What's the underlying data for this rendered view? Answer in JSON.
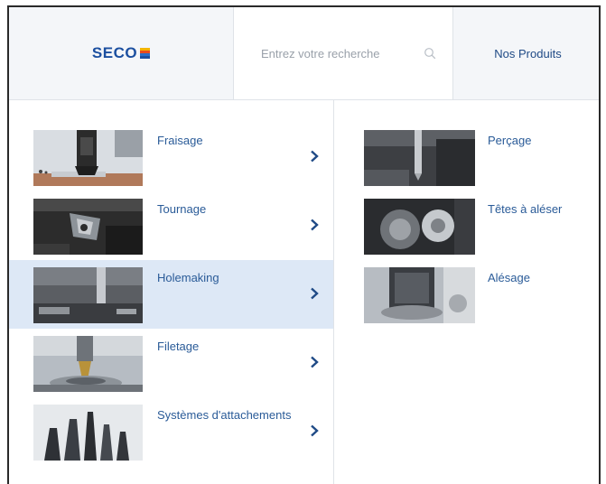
{
  "header": {
    "logo_text": "SECO",
    "search_placeholder": "Entrez votre recherche",
    "products_label": "Nos Produits"
  },
  "categories": [
    {
      "label": "Fraisage",
      "active": false
    },
    {
      "label": "Tournage",
      "active": false
    },
    {
      "label": "Holemaking",
      "active": true
    },
    {
      "label": "Filetage",
      "active": false
    },
    {
      "label": "Systèmes d'attachements",
      "active": false
    }
  ],
  "subcategories": [
    {
      "label": "Perçage"
    },
    {
      "label": "Têtes à aléser"
    },
    {
      "label": "Alésage"
    }
  ],
  "colors": {
    "brand_blue": "#1b4fa0",
    "link_blue": "#2a5b98",
    "active_row": "#dde8f6",
    "header_bg": "#f4f6f9",
    "chevron": "#1f4a86"
  },
  "icons": {
    "search": "search-icon",
    "chevron": "chevron-right-icon"
  }
}
